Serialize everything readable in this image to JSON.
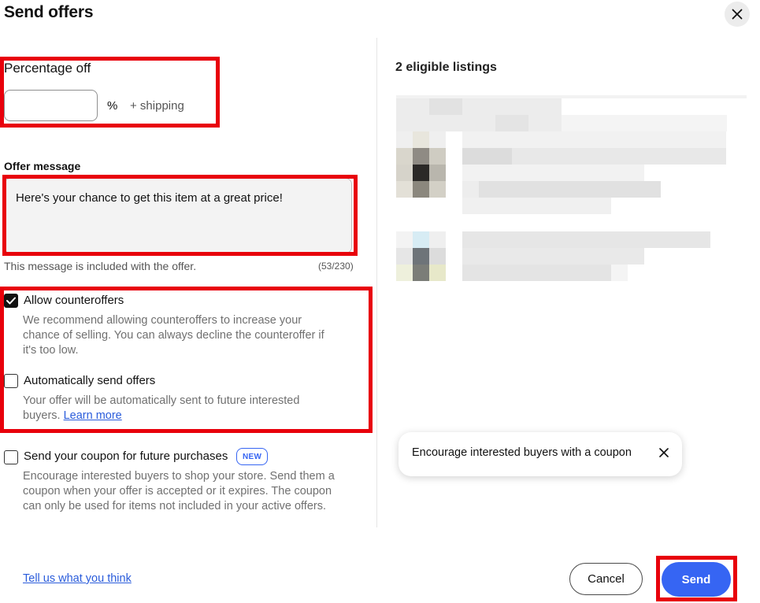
{
  "dialog": {
    "title": "Send offers",
    "close_icon": "close-icon"
  },
  "percentage": {
    "label": "Percentage off",
    "value": "",
    "unit": "%",
    "shipping_note": "+ shipping"
  },
  "message": {
    "label": "Offer message",
    "value": "Here's your chance to get this item at a great price!",
    "help": "This message is included with the offer.",
    "count": "(53/230)"
  },
  "options": {
    "counteroffers": {
      "label": "Allow counteroffers",
      "checked": true,
      "desc_lines": [
        "We recommend allowing counteroffers to increase your",
        "chance of selling. You can always decline the counteroffer if",
        "it's too low."
      ]
    },
    "auto_send": {
      "label": "Automatically send offers",
      "checked": false,
      "desc_lines": [
        "Your offer will be automatically sent to future interested"
      ],
      "desc_last": "buyers.",
      "learn_more": "Learn more"
    },
    "coupon": {
      "label": "Send your coupon for future purchases",
      "checked": false,
      "badge": "NEW",
      "desc_lines": [
        "Encourage interested buyers to shop your store. Send them a",
        "coupon when your offer is accepted or it expires. The coupon",
        "can only be used for items not included in your active offers."
      ]
    }
  },
  "listings": {
    "heading": "2 eligible listings"
  },
  "tooltip": {
    "text": "Encourage interested buyers with a coupon",
    "close_icon": "close-icon"
  },
  "footer": {
    "feedback_link": "Tell us what you think",
    "cancel_label": "Cancel",
    "send_label": "Send"
  },
  "colors": {
    "highlight": "#e8000b",
    "primary": "#3665f3",
    "link": "#2a5cdb"
  }
}
